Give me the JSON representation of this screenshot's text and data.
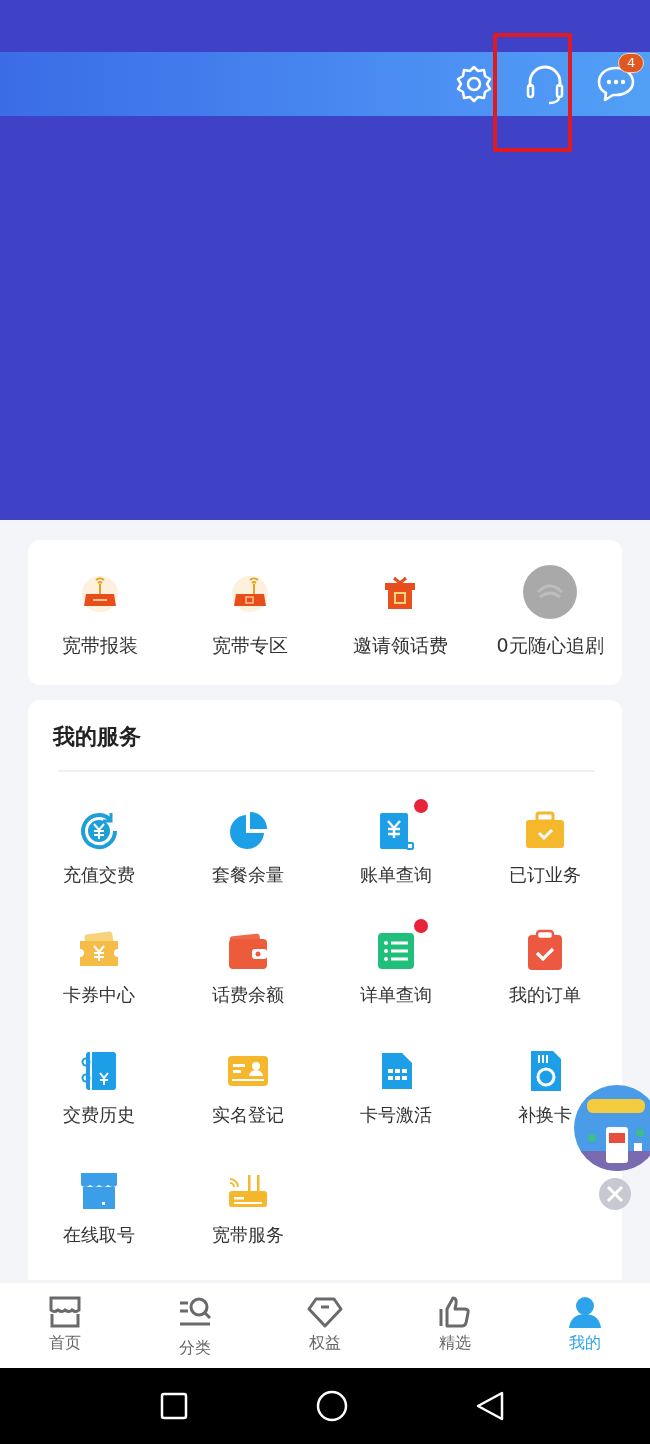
{
  "header": {
    "message_badge": "4"
  },
  "quick_links": [
    {
      "label": "宽带报装"
    },
    {
      "label": "宽带专区"
    },
    {
      "label": "邀请领话费"
    },
    {
      "label": "0元随心追剧"
    }
  ],
  "services": {
    "title": "我的服务",
    "items": [
      {
        "label": "充值交费",
        "dot": false
      },
      {
        "label": "套餐余量",
        "dot": false
      },
      {
        "label": "账单查询",
        "dot": true
      },
      {
        "label": "已订业务",
        "dot": false
      },
      {
        "label": "卡券中心",
        "dot": false
      },
      {
        "label": "话费余额",
        "dot": false
      },
      {
        "label": "详单查询",
        "dot": true
      },
      {
        "label": "我的订单",
        "dot": false
      },
      {
        "label": "交费历史",
        "dot": false
      },
      {
        "label": "实名登记",
        "dot": false
      },
      {
        "label": "卡号激活",
        "dot": false
      },
      {
        "label": "补换卡",
        "dot": false
      },
      {
        "label": "在线取号",
        "dot": false
      },
      {
        "label": "宽带服务",
        "dot": false
      }
    ]
  },
  "tab_bar": [
    {
      "label": "首页",
      "selected": false
    },
    {
      "label": "分类",
      "selected": false
    },
    {
      "label": "权益",
      "selected": false
    },
    {
      "label": "精选",
      "selected": false
    },
    {
      "label": "我的",
      "selected": true
    }
  ]
}
